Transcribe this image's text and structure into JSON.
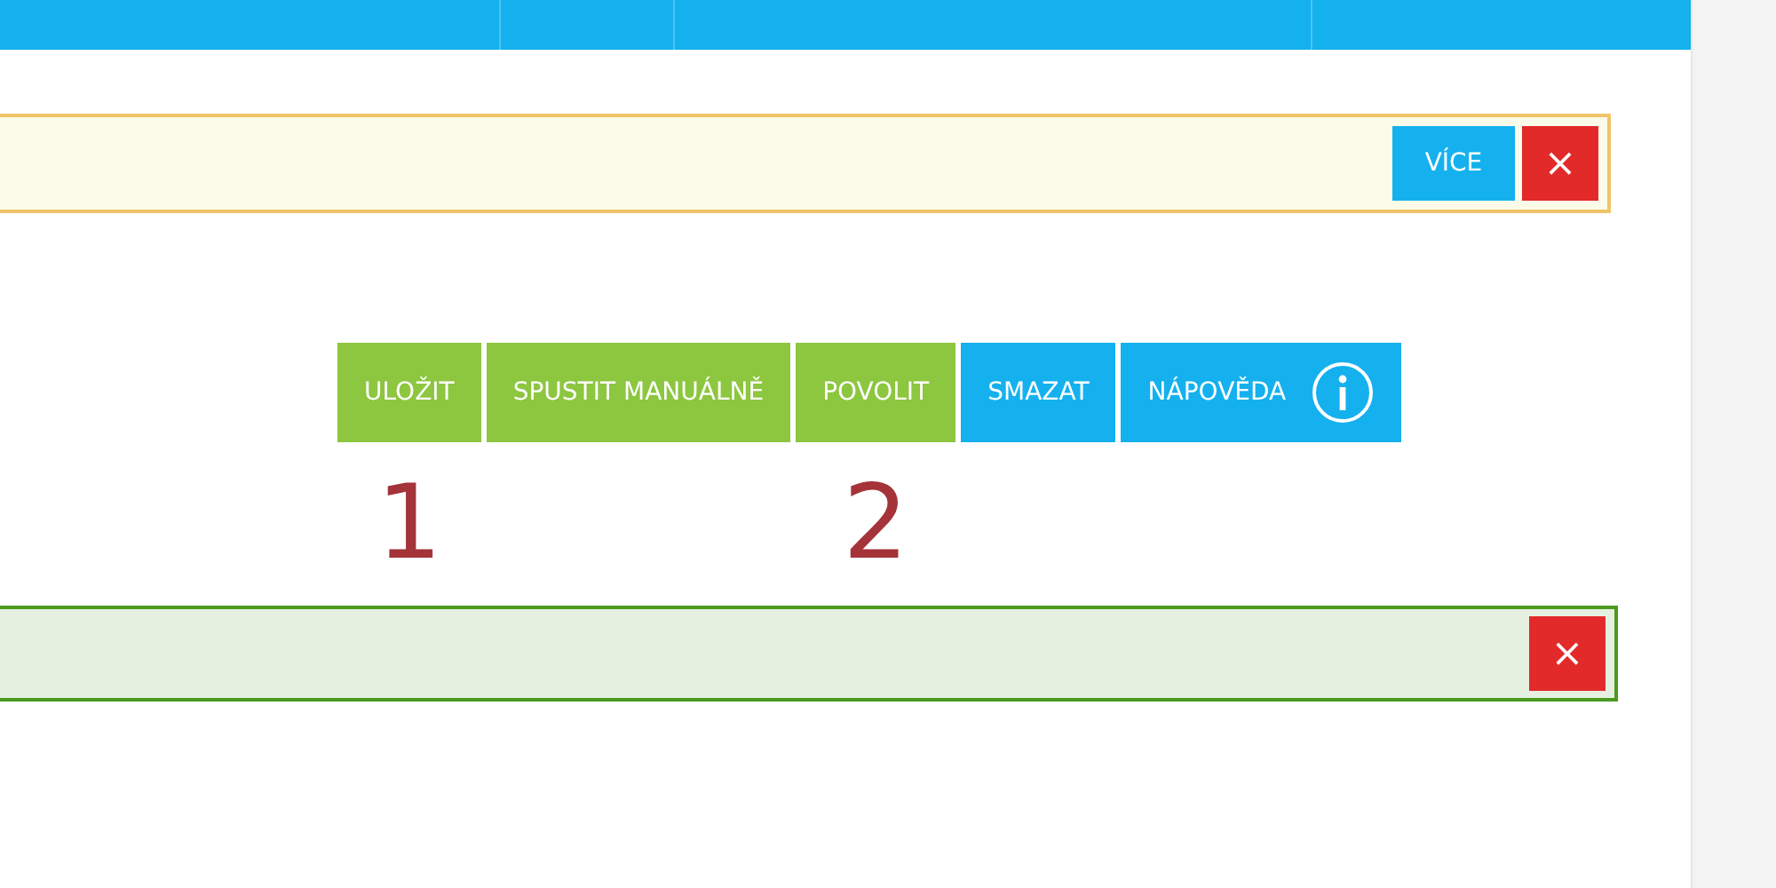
{
  "notice": {
    "buttons": [
      {
        "kind": "more",
        "label": "VÍCE"
      },
      {
        "kind": "close",
        "label": "×"
      }
    ]
  },
  "toolbar": [
    {
      "label": "ULOŽIT",
      "color": "#8dc63f",
      "marker": "1"
    },
    {
      "label": "SPUSTIT MANUÁLNĚ",
      "color": "#8dc63f"
    },
    {
      "label": "POVOLIT",
      "color": "#8dc63f",
      "marker": "2"
    },
    {
      "label": "SMAZAT",
      "color": "#15b1ee"
    },
    {
      "label": "NÁPOVĚDA",
      "color": "#15b1ee",
      "info": true
    }
  ],
  "success": {
    "buttons": [
      {
        "kind": "close",
        "label": "×"
      }
    ]
  }
}
